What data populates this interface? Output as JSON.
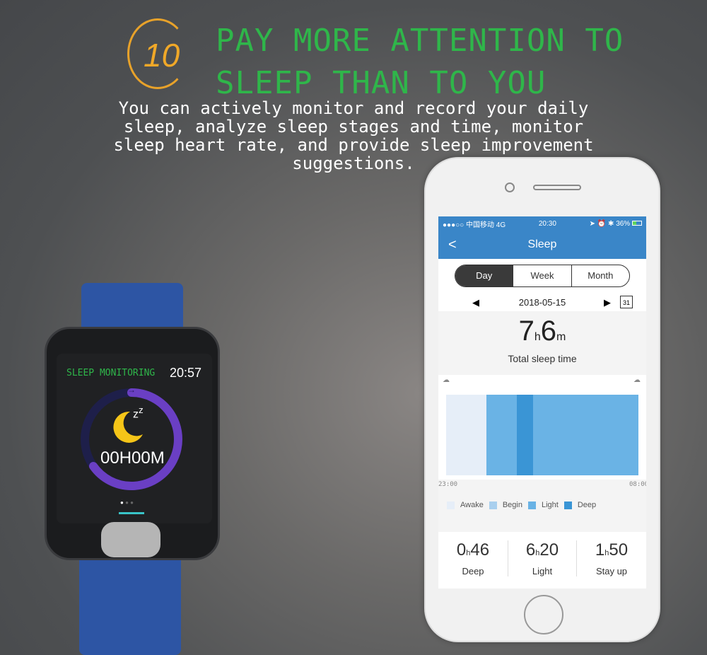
{
  "badge_number": "10",
  "headline": [
    "PAY MORE ATTENTION TO",
    "SLEEP THAN TO YOU"
  ],
  "description": [
    "You can actively monitor and record your daily",
    "sleep, analyze sleep stages and time, monitor",
    "sleep heart rate, and provide sleep improvement",
    "suggestions."
  ],
  "watch": {
    "title": "SLEEP MONITORING",
    "time": "20:57",
    "duration": "00H00M",
    "colors": {
      "title": "#2fb64a",
      "ring": "#6a3fc4",
      "moon": "#f5c518"
    }
  },
  "phone": {
    "status": {
      "carrier": "●●●○○ 中国移动",
      "network": "4G",
      "time": "20:30",
      "battery": "36%"
    },
    "nav_title": "Sleep",
    "back": "<",
    "tabs": [
      "Day",
      "Week",
      "Month"
    ],
    "active_tab": "Day",
    "date": "2018-05-15",
    "calendar": "31",
    "total": {
      "hours": "7",
      "h": "h",
      "minutes": "6",
      "m": "m",
      "label": "Total sleep time"
    },
    "axis": {
      "start": "23:00",
      "end": "08:00"
    },
    "legend": [
      {
        "label": "Awake",
        "color": "#e6eef8"
      },
      {
        "label": "Begin",
        "color": "#a9cfee"
      },
      {
        "label": "Light",
        "color": "#6ab3e5"
      },
      {
        "label": "Deep",
        "color": "#3a95d5"
      }
    ],
    "stats": [
      {
        "h": "0",
        "m": "46",
        "label": "Deep"
      },
      {
        "h": "6",
        "m": "20",
        "label": "Light"
      },
      {
        "h": "1",
        "m": "50",
        "label": "Stay up"
      }
    ],
    "h_unit": "h",
    "accent": "#3a86c8"
  }
}
